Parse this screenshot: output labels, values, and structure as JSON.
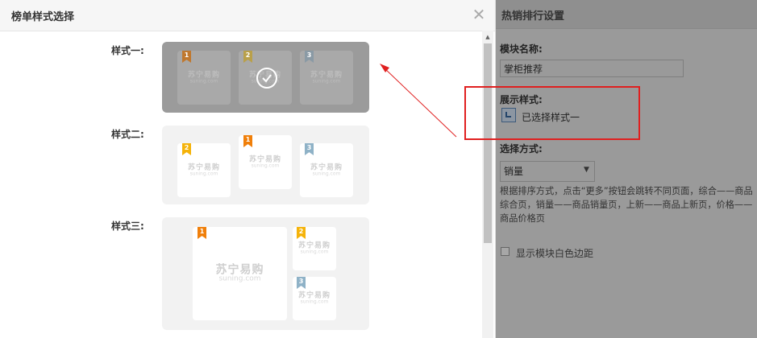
{
  "dialog": {
    "title": "榜单样式选择",
    "close_icon": "close-icon",
    "styles": [
      {
        "label": "样式一:",
        "selected": true
      },
      {
        "label": "样式二:",
        "selected": false
      },
      {
        "label": "样式三:",
        "selected": false
      }
    ],
    "brand_main": "苏宁易购",
    "brand_sub": "suning.com",
    "rank_badges": [
      "1",
      "2",
      "3"
    ]
  },
  "panel": {
    "title": "热销排行设置",
    "module_name_label": "模块名称:",
    "module_name_value": "掌柜推荐",
    "display_style_label": "展示样式:",
    "selected_style_text": "已选择样式一",
    "select_method_label": "选择方式:",
    "select_value": "销量",
    "description": "根据排序方式，点击“更多”按钮会跳转不同页面，综合——商品综合页，销量——商品销量页，上新——商品上新页，价格——商品价格页",
    "margin_checkbox_label": "显示模块白色边距",
    "margin_checked": false
  },
  "colors": {
    "annotation": "#e02020",
    "rank1": "#f07f0a",
    "rank2": "#f5b30a",
    "rank3": "#8fb2c7"
  }
}
